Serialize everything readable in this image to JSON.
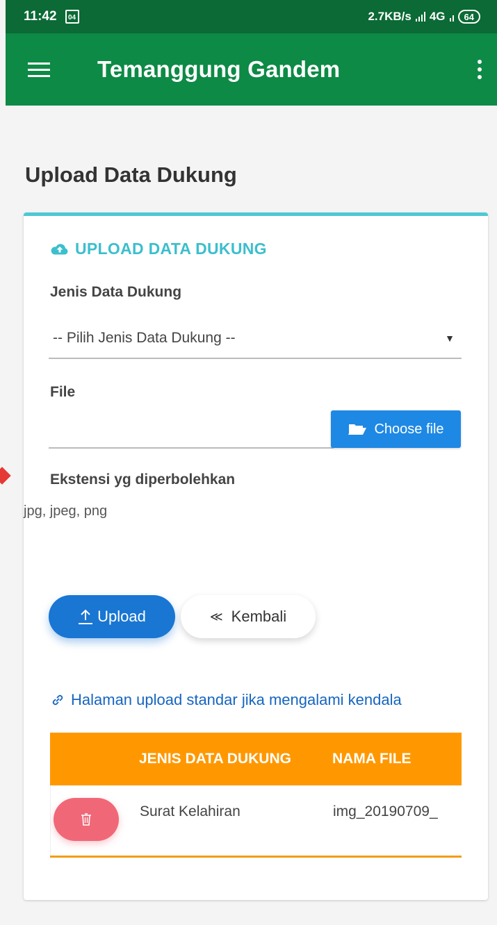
{
  "status_bar": {
    "time": "11:42",
    "calendar_day": "04",
    "network_speed": "2.7KB/s",
    "network_type": "4G",
    "battery": "64"
  },
  "app_bar": {
    "title": "Temanggung Gandem"
  },
  "page": {
    "title": "Upload Data Dukung"
  },
  "card": {
    "header": "UPLOAD DATA DUKUNG",
    "jenis_label": "Jenis Data Dukung",
    "jenis_select_value": "-- Pilih Jenis Data Dukung --",
    "file_label": "File",
    "choose_file_label": "Choose file",
    "ext_label": "Ekstensi yg diperbolehkan",
    "ext_values": "jpg, jpeg, png",
    "upload_label": "Upload",
    "back_label": "Kembali",
    "fallback_link": "Halaman upload standar jika mengalami kendala"
  },
  "table": {
    "columns": [
      "JENIS DATA DUKUNG",
      "NAMA FILE"
    ],
    "rows": [
      {
        "jenis": "Surat Kelahiran",
        "nama_file": "img_20190709_"
      }
    ]
  },
  "colors": {
    "status_bar": "#0b6a35",
    "app_bar": "#0d8a45",
    "accent_teal": "#3bbfcd",
    "primary_blue": "#1976d2",
    "table_header": "#ff9800",
    "delete_button": "#f06878"
  }
}
